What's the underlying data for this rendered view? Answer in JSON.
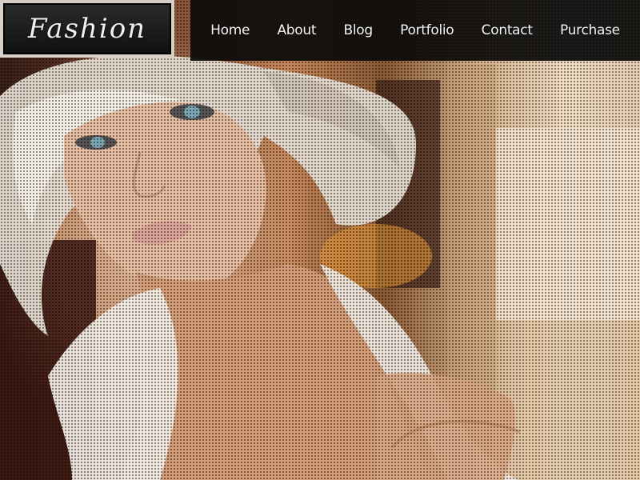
{
  "header": {
    "logo_text": "Fashion"
  },
  "nav": {
    "items": [
      {
        "label": "Home"
      },
      {
        "label": "About"
      },
      {
        "label": "Blog"
      },
      {
        "label": "Portfolio"
      },
      {
        "label": "Contact"
      },
      {
        "label": "Purchase"
      }
    ]
  },
  "colors": {
    "nav_background": "#0a0a0a",
    "nav_text": "#f4f4f4",
    "logo_frame": "#d8d0c6",
    "logo_background": "#111111"
  }
}
